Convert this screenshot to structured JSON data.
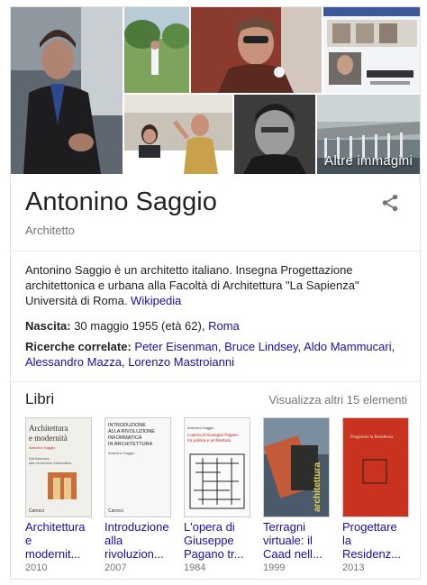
{
  "photos": {
    "more_label": "Altre immagini"
  },
  "entity": {
    "name": "Antonino Saggio",
    "type": "Architetto"
  },
  "description": {
    "text": "Antonino Saggio è un architetto italiano. Insegna Progettazione architettonica e urbana alla Facoltà di Architettura \"La Sapienza\" Università di Roma. ",
    "source_link": "Wikipedia"
  },
  "facts": {
    "birth_label": "Nascita:",
    "birth_value": " 30 maggio 1955 (età 62), ",
    "birth_place": "Roma",
    "related_label": "Ricerche correlate:",
    "related": [
      "Peter Eisenman",
      "Bruce Lindsey",
      "Aldo Mammucari",
      "Alessandro Mazza",
      "Lorenzo Mastroianni"
    ]
  },
  "books_section": {
    "heading": "Libri",
    "more": "Visualizza altri 15 elementi",
    "items": [
      {
        "title_line1": "Architettura",
        "title_line2": "e",
        "title_line3": "modernit...",
        "year": "2010",
        "cover_title": "Architettura e modernità",
        "cover_author": "Antonino Saggio",
        "cover_sub": "Dal Bauhaus alla rivoluzione informatica",
        "cover_publisher": "Carocci"
      },
      {
        "title_line1": "Introduzione",
        "title_line2": "alla",
        "title_line3": "rivoluzion...",
        "year": "2007",
        "cover_title": "INTRODUZIONE ALLA RIVOLUZIONE INFORMATICA IN ARCHITETTURA",
        "cover_author": "Antonino Saggio",
        "cover_publisher": "Carocci"
      },
      {
        "title_line1": "L'opera di",
        "title_line2": "Giuseppe",
        "title_line3": "Pagano tr...",
        "year": "1984",
        "cover_title": "L'opera di Giuseppe Pagano tra politica e architettura"
      },
      {
        "title_line1": "Terragni",
        "title_line2": "virtuale: il",
        "title_line3": "Caad nell...",
        "year": "1999",
        "cover_title": "architettura"
      },
      {
        "title_line1": "Progettare",
        "title_line2": "la",
        "title_line3": "Residenz...",
        "year": "2013",
        "cover_title": "Progettare la Residenza"
      }
    ]
  }
}
